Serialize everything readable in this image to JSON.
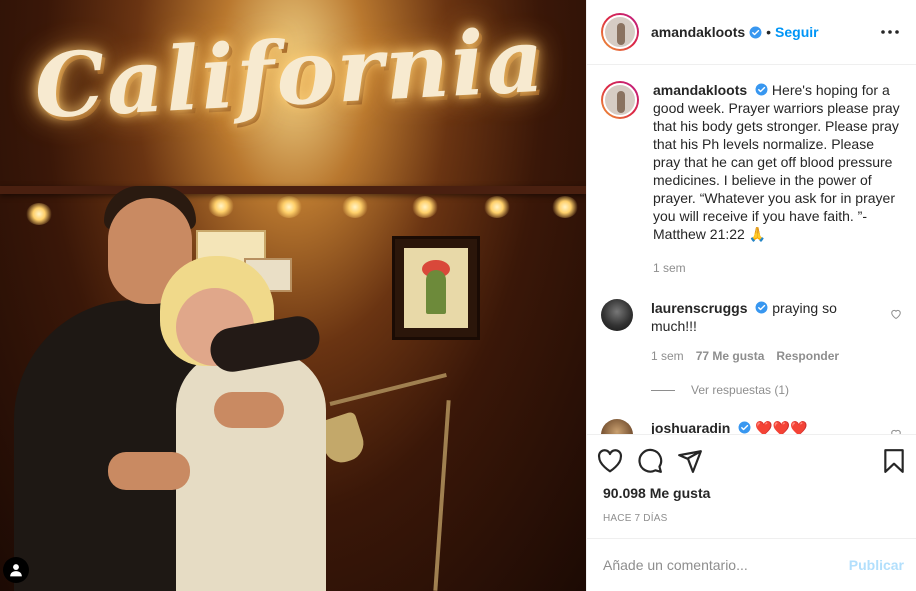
{
  "header": {
    "username": "amandakloots",
    "dot": "•",
    "follow_label": "Seguir"
  },
  "photo": {
    "sign_text": "California"
  },
  "caption": {
    "username": "amandakloots",
    "text": "Here's hoping for a good week. Prayer warriors please pray that his body gets stronger. Please pray that his Ph levels normalize. Please pray that he can get off blood pressure medicines. I believe in the power of prayer. “Whatever you ask for in prayer you will receive if you have faith. ”- Matthew 21:22 🙏",
    "time": "1 sem"
  },
  "comments": [
    {
      "username": "laurenscruggs",
      "text": "praying so much!!!",
      "time": "1 sem",
      "likes": "77 Me gusta",
      "reply_label": "Responder",
      "view_replies": "Ver respuestas (1)"
    },
    {
      "username": "joshuaradin",
      "text": "❤️❤️❤️"
    }
  ],
  "actions": {
    "likes": "90.098 Me gusta",
    "date": "HACE 7 DÍAS"
  },
  "add_comment": {
    "placeholder": "Añade un comentario...",
    "publish_label": "Publicar"
  },
  "colors": {
    "link_blue": "#0095f6",
    "verified_blue": "#3897f0",
    "publish_disabled": "#b2dffc",
    "heart_red": "#ed4956"
  },
  "icons": [
    "more-options-icon",
    "verified-badge-icon",
    "heart-icon",
    "comment-icon",
    "share-icon",
    "bookmark-icon",
    "user-tag-icon"
  ]
}
